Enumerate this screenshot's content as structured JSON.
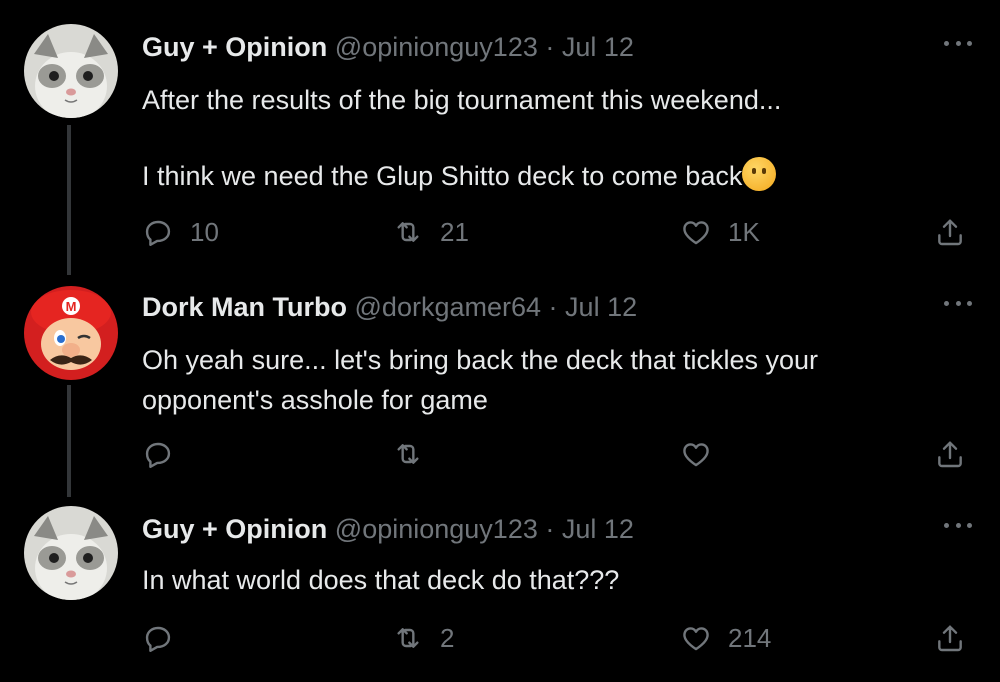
{
  "tweets": [
    {
      "name": "Guy + Opinion",
      "handle": "@opinionguy123",
      "separator": "·",
      "date": "Jul 12",
      "text_line1": "After the results of the big tournament this weekend...",
      "text_line2": "I think we need the Glup Shitto deck to come back",
      "emoji": "thinking-face",
      "replies": "10",
      "retweets": "21",
      "likes": "1K"
    },
    {
      "name": "Dork Man Turbo",
      "handle": "@dorkgamer64",
      "separator": "·",
      "date": "Jul 12",
      "text_line1": "Oh yeah sure... let's bring back the deck that tickles your",
      "text_line2": "opponent's asshole for game",
      "replies": "",
      "retweets": "",
      "likes": ""
    },
    {
      "name": "Guy + Opinion",
      "handle": "@opinionguy123",
      "separator": "·",
      "date": "Jul 12",
      "text_line1": "In what world does that deck do that???",
      "replies": "",
      "retweets": "2",
      "likes": "214"
    }
  ],
  "colors": {
    "background": "#000000",
    "text": "#e7e9ea",
    "muted": "#71767b",
    "thread_line": "#333639"
  },
  "icons": [
    "reply-icon",
    "retweet-icon",
    "like-icon",
    "share-icon",
    "more-icon"
  ]
}
